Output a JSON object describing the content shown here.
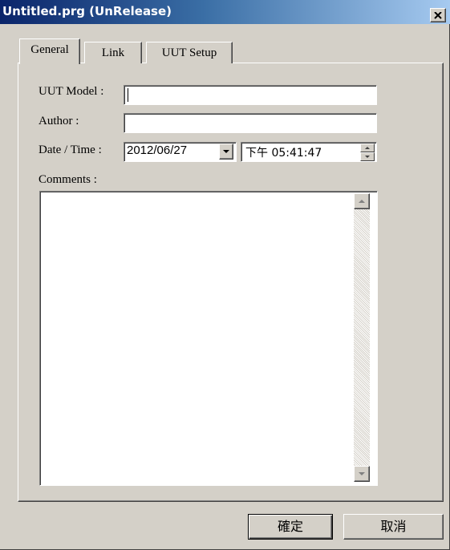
{
  "window": {
    "title": "Untitled.prg (UnRelease)",
    "close_glyph": "✕",
    "colors": {
      "face": "#d4d0c8",
      "title_start": "#0a246a",
      "title_end": "#a6caf0"
    }
  },
  "tabs": [
    {
      "label": "General",
      "active": true
    },
    {
      "label": "Link",
      "active": false
    },
    {
      "label": "UUT Setup",
      "active": false
    }
  ],
  "general": {
    "uut_model_label": "UUT Model :",
    "uut_model_value": "",
    "author_label": "Author :",
    "author_value": "",
    "datetime_label": "Date / Time :",
    "date_value": "2012/06/27",
    "time_value": "下午 05:41:47",
    "comments_label": "Comments :",
    "comments_value": ""
  },
  "buttons": {
    "ok_label": "確定",
    "cancel_label": "取消"
  },
  "icons": {
    "close": "close-icon",
    "dropdown": "chevron-down-icon",
    "spin_up": "spin-up-icon",
    "spin_down": "spin-down-icon",
    "scroll_up": "scroll-up-arrow-icon",
    "scroll_down": "scroll-down-arrow-icon"
  }
}
